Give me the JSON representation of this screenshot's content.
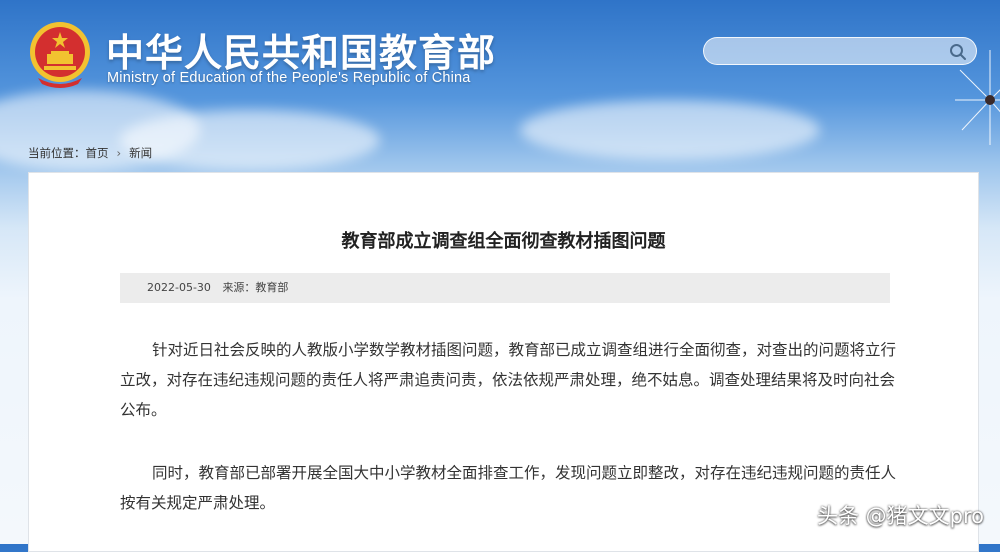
{
  "header": {
    "site_title": "中华人民共和国教育部",
    "site_subtitle": "Ministry of Education of the People's Republic of China",
    "search": {
      "value": "",
      "placeholder": ""
    }
  },
  "breadcrumb": {
    "prefix": "当前位置：",
    "home": "首页",
    "separator": "›",
    "current": "新闻"
  },
  "article": {
    "title": "教育部成立调查组全面彻查教材插图问题",
    "date": "2022-05-30",
    "source": "来源：教育部",
    "paragraphs": [
      "针对近日社会反映的人教版小学数学教材插图问题，教育部已成立调查组进行全面彻查，对查出的问题将立行立改，对存在违纪违规问题的责任人将严肃追责问责，依法依规严肃处理，绝不姑息。调查处理结果将及时向社会公布。",
      "同时，教育部已部署开展全国大中小学教材全面排查工作，发现问题立即整改，对存在违纪违规问题的责任人按有关规定严肃处理。"
    ]
  },
  "watermark": "头条 @猪文文pro",
  "colors": {
    "header_blue": "#2f74c8",
    "emblem_red": "#d32f2f",
    "emblem_gold": "#f2c230",
    "meta_bar": "#ececec"
  },
  "icons": {
    "emblem": "national-emblem-icon",
    "search": "search-icon"
  }
}
